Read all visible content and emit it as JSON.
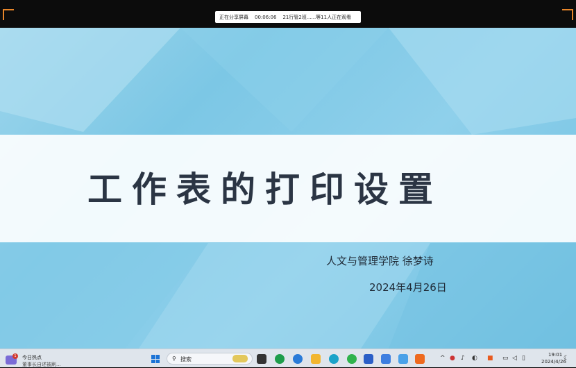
{
  "sharebar": {
    "status": "正在分享屏幕",
    "timer": "00:06:06",
    "viewers": "21行管2班......等11人正在观看"
  },
  "slide": {
    "title": "工作表的打印设置",
    "author": "人文与管理学院   徐梦诗",
    "date": "2024年4月26日"
  },
  "taskbar": {
    "news_badge": "1",
    "news_title": "今日热点",
    "news_sub": "董事长自述被刷...",
    "search_placeholder": "搜索",
    "time": "19:01",
    "date": "2024/4/26"
  }
}
